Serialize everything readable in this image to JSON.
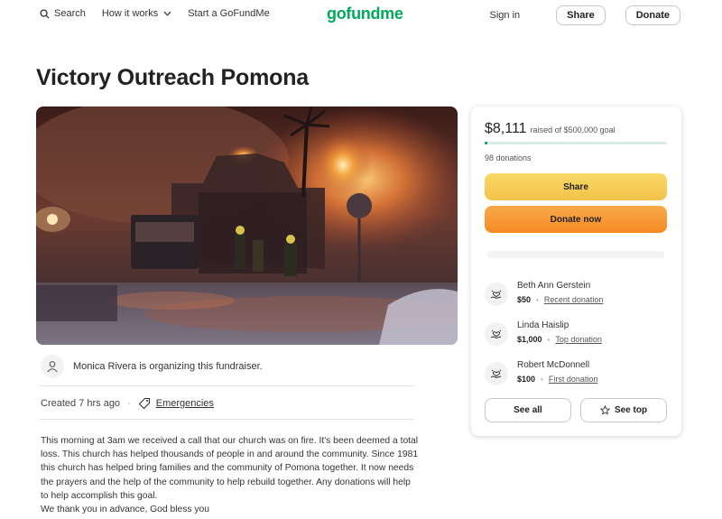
{
  "nav": {
    "search": "Search",
    "how_it_works": "How it works",
    "start": "Start a GoFundMe",
    "logo": "gofundme",
    "signin": "Sign in",
    "share": "Share",
    "donate": "Donate"
  },
  "title": "Victory Outreach Pomona",
  "organizer": "Monica Rivera is organizing this fundraiser.",
  "meta": {
    "created": "Created 7 hrs ago",
    "category": "Emergencies"
  },
  "story": [
    "This morning at 3am we received a call that our church was on fire. It's been deemed a total loss. This church has helped thousands of people in and around the community. Since 1981 this church has helped bring families and the community of Pomona together. It now needs the prayers and the help of the community to help rebuild together. Any donations will help to help accomplish this goal.",
    "We thank you in advance, God bless you"
  ],
  "card": {
    "raised": "$8,111",
    "goal_text": "raised of $500,000 goal",
    "progress_fraction": 0.0162,
    "donations": "98 donations",
    "share_btn": "Share",
    "donate_btn": "Donate now",
    "donors": [
      {
        "name": "Beth Ann Gerstein",
        "amount": "$50",
        "label": "Recent donation"
      },
      {
        "name": "Linda Haislip",
        "amount": "$1,000",
        "label": "Top donation"
      },
      {
        "name": "Robert McDonnell",
        "amount": "$100",
        "label": "First donation"
      }
    ],
    "see_all": "See all",
    "see_top": "See top"
  },
  "colors": {
    "brand": "#02a95c",
    "share_button": "#f3c34a",
    "donate_button": "#f58a22"
  },
  "icons": [
    "search-icon",
    "chevron-down-icon",
    "user-icon",
    "tag-icon",
    "heart-hand-icon",
    "star-icon"
  ]
}
